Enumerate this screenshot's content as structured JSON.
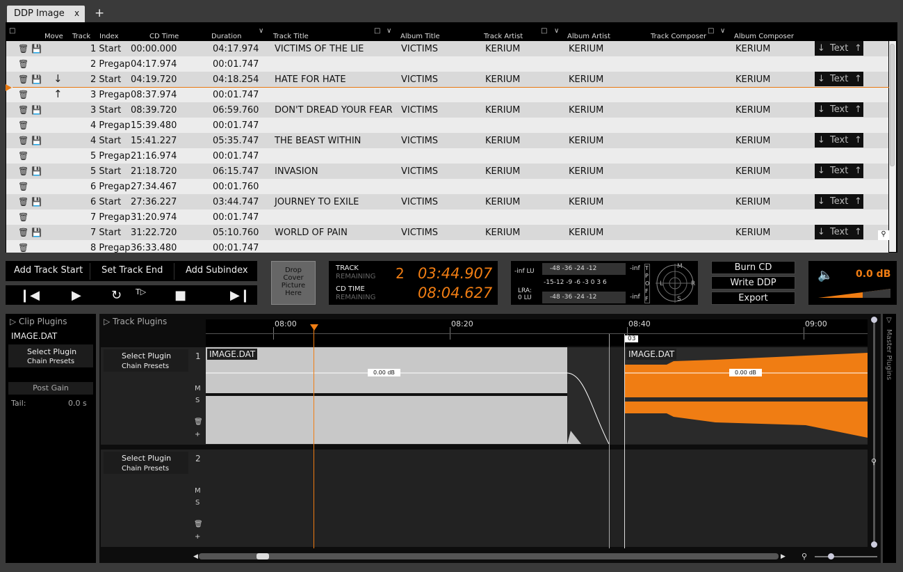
{
  "tabs": {
    "active": "DDP Image",
    "close": "x",
    "add": "+"
  },
  "table": {
    "headers": {
      "move": "Move",
      "track": "Track",
      "index": "Index",
      "cdtime": "CD Time",
      "duration": "Duration",
      "title": "Track Title",
      "album": "Album Title",
      "artist": "Track Artist",
      "albumartist": "Album Artist",
      "composer": "Track Composer",
      "albumcomposer": "Album Composer"
    },
    "rows": [
      {
        "idx": "1 Start",
        "time": "00:00.000",
        "dur": "04:17.974",
        "title": "VICTIMS OF THE LIE",
        "album": "VICTIMS",
        "artist": "KERIUM",
        "aartist": "KERIUM",
        "acomp": "KERIUM",
        "text": "Text"
      },
      {
        "idx": "2 Pregap",
        "time": "04:17.974",
        "dur": "00:01.747"
      },
      {
        "idx": "2 Start",
        "time": "04:19.720",
        "dur": "04:18.254",
        "title": "HATE FOR HATE",
        "album": "VICTIMS",
        "artist": "KERIUM",
        "aartist": "KERIUM",
        "acomp": "KERIUM",
        "text": "Text"
      },
      {
        "idx": "3 Pregap",
        "time": "08:37.974",
        "dur": "00:01.747"
      },
      {
        "idx": "3 Start",
        "time": "08:39.720",
        "dur": "06:59.760",
        "title": "DON'T DREAD YOUR FEAR",
        "album": "VICTIMS",
        "artist": "KERIUM",
        "aartist": "KERIUM",
        "acomp": "KERIUM",
        "text": "Text"
      },
      {
        "idx": "4 Pregap",
        "time": "15:39.480",
        "dur": "00:01.747"
      },
      {
        "idx": "4 Start",
        "time": "15:41.227",
        "dur": "05:35.747",
        "title": "THE BEAST WITHIN",
        "album": "VICTIMS",
        "artist": "KERIUM",
        "aartist": "KERIUM",
        "acomp": "KERIUM",
        "text": "Text"
      },
      {
        "idx": "5 Pregap",
        "time": "21:16.974",
        "dur": "00:01.747"
      },
      {
        "idx": "5 Start",
        "time": "21:18.720",
        "dur": "06:15.747",
        "title": "INVASION",
        "album": "VICTIMS",
        "artist": "KERIUM",
        "aartist": "KERIUM",
        "acomp": "KERIUM",
        "text": "Text"
      },
      {
        "idx": "6 Pregap",
        "time": "27:34.467",
        "dur": "00:01.760"
      },
      {
        "idx": "6 Start",
        "time": "27:36.227",
        "dur": "03:44.747",
        "title": "JOURNEY TO EXILE",
        "album": "VICTIMS",
        "artist": "KERIUM",
        "aartist": "KERIUM",
        "acomp": "KERIUM",
        "text": "Text"
      },
      {
        "idx": "7 Pregap",
        "time": "31:20.974",
        "dur": "00:01.747"
      },
      {
        "idx": "7 Start",
        "time": "31:22.720",
        "dur": "05:10.760",
        "title": "WORLD OF PAIN",
        "album": "VICTIMS",
        "artist": "KERIUM",
        "aartist": "KERIUM",
        "acomp": "KERIUM",
        "text": "Text"
      },
      {
        "idx": "8 Pregap",
        "time": "36:33.480",
        "dur": "00:01.747"
      }
    ]
  },
  "toolbar": {
    "add_track_start": "Add Track Start",
    "set_track_end": "Set Track End",
    "add_subindex": "Add Subindex"
  },
  "cover": {
    "l1": "Drop",
    "l2": "Cover",
    "l3": "Picture",
    "l4": "Here"
  },
  "counter": {
    "track_label": "TRACK",
    "remaining": "REMAINING",
    "track_num": "2",
    "track_time": "03:44.907",
    "cd_label": "CD TIME",
    "cd_remaining": "REMAINING",
    "cd_time": "08:04.627"
  },
  "meter": {
    "inf_lu": "-inf  LU",
    "lra": "LRA:",
    "lra_val": "0 LU",
    "inf_r1": "-inf",
    "inf_r2": "-inf",
    "scale_top": "-48   -36   -24   -12",
    "scale_mid": "-15-12 -9  -6  -3  0   3   6",
    "scale_bot": "-48   -36   -24   -12",
    "tpoff": "T P O F F",
    "l": "L",
    "r": "R",
    "m": "M",
    "s": "S"
  },
  "actions": {
    "burn": "Burn CD",
    "write": "Write DDP",
    "export": "Export"
  },
  "volume": {
    "db": "0.0 dB"
  },
  "clip_plugins": {
    "title": "Clip Plugins",
    "file": "IMAGE.DAT",
    "select": "Select Plugin",
    "chain": "Chain Presets",
    "post_gain": "Post Gain",
    "tail": "Tail:",
    "tail_val": "0.0 s"
  },
  "track_plugins": {
    "title": "Track Plugins"
  },
  "ruler": {
    "t1": "08:00",
    "t2": "08:20",
    "t3": "08:40",
    "t4": "09:00",
    "marker": "03"
  },
  "lanes": [
    {
      "num": "1",
      "select": "Select Plugin",
      "chain": "Chain Presets",
      "m": "M",
      "s": "S",
      "plus": "+"
    },
    {
      "num": "2",
      "select": "Select Plugin",
      "chain": "Chain Presets",
      "m": "M",
      "s": "S",
      "plus": "+"
    }
  ],
  "clips": {
    "name1": "IMAGE.DAT",
    "gain1": "0.00 dB",
    "name2": "IMAGE.DAT",
    "gain2": "0.00 dB"
  },
  "master": {
    "label": "Master Plugins"
  },
  "colors": {
    "accent": "#f07d13"
  }
}
